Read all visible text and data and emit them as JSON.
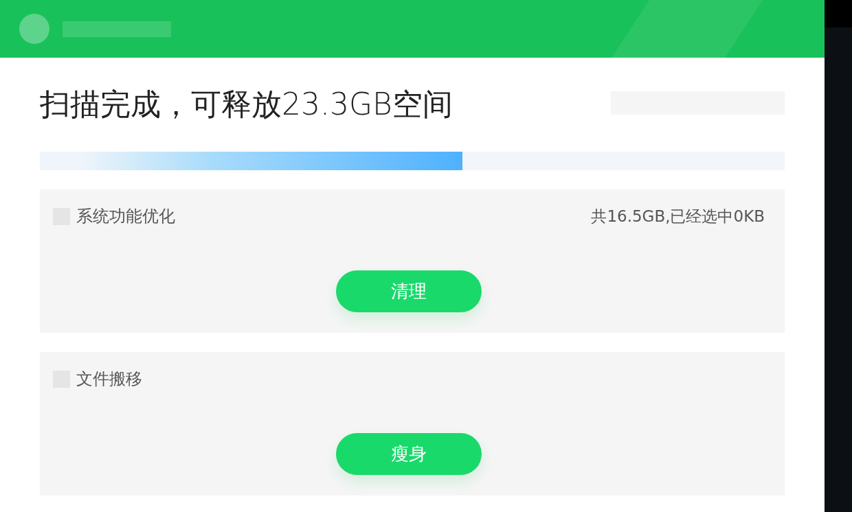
{
  "title": "扫描完成，可释放23.3GB空间",
  "progress": {
    "level": 0.567
  },
  "sections": [
    {
      "label": "系统功能优化",
      "checked": false,
      "summary": "共16.5GB,已经选中0KB",
      "button": "清理"
    },
    {
      "label": "文件搬移",
      "checked": false,
      "button": "瘦身"
    }
  ]
}
